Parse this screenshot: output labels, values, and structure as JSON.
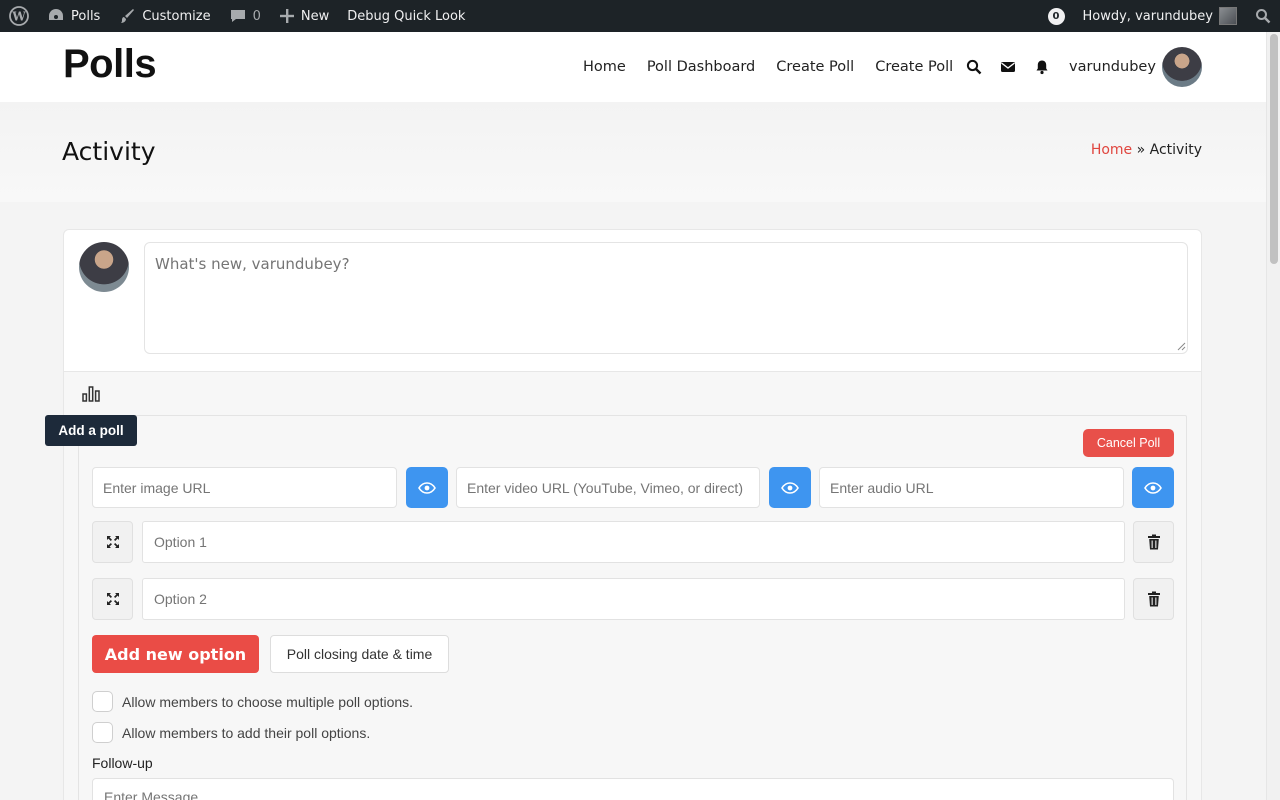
{
  "adminbar": {
    "wp_logo_icon": "wordpress-icon",
    "site_name": "Polls",
    "customize": "Customize",
    "comments_count": "0",
    "new_label": "New",
    "debug_label": "Debug Quick Look",
    "notif_count": "0",
    "howdy": "Howdy, varundubey"
  },
  "header": {
    "site_title": "Polls",
    "nav": [
      "Home",
      "Poll Dashboard",
      "Create Poll",
      "Create Poll"
    ],
    "username": "varundubey"
  },
  "page": {
    "title": "Activity",
    "breadcrumb_home": "Home",
    "breadcrumb_sep": " » ",
    "breadcrumb_current": "Activity"
  },
  "post_form": {
    "placeholder": "What's new, varundubey?",
    "tooltip": "Add a poll"
  },
  "poll": {
    "cancel_label": "Cancel Poll",
    "image_placeholder": "Enter image URL",
    "video_placeholder": "Enter video URL (YouTube, Vimeo, or direct)",
    "audio_placeholder": "Enter audio URL",
    "options": [
      {
        "placeholder": "Option 1"
      },
      {
        "placeholder": "Option 2"
      }
    ],
    "add_option_label": "Add new option",
    "closing_date_label": "Poll closing date & time",
    "allow_multiple": "Allow members to choose multiple poll options.",
    "allow_add": "Allow members to add their poll options.",
    "followup_label": "Follow-up",
    "followup_placeholder": "Enter Message"
  },
  "colors": {
    "accent_red": "#ea4c46",
    "accent_blue": "#3e95f0",
    "adminbar_bg": "#1d2327",
    "tooltip_bg": "#1d2a3a"
  }
}
